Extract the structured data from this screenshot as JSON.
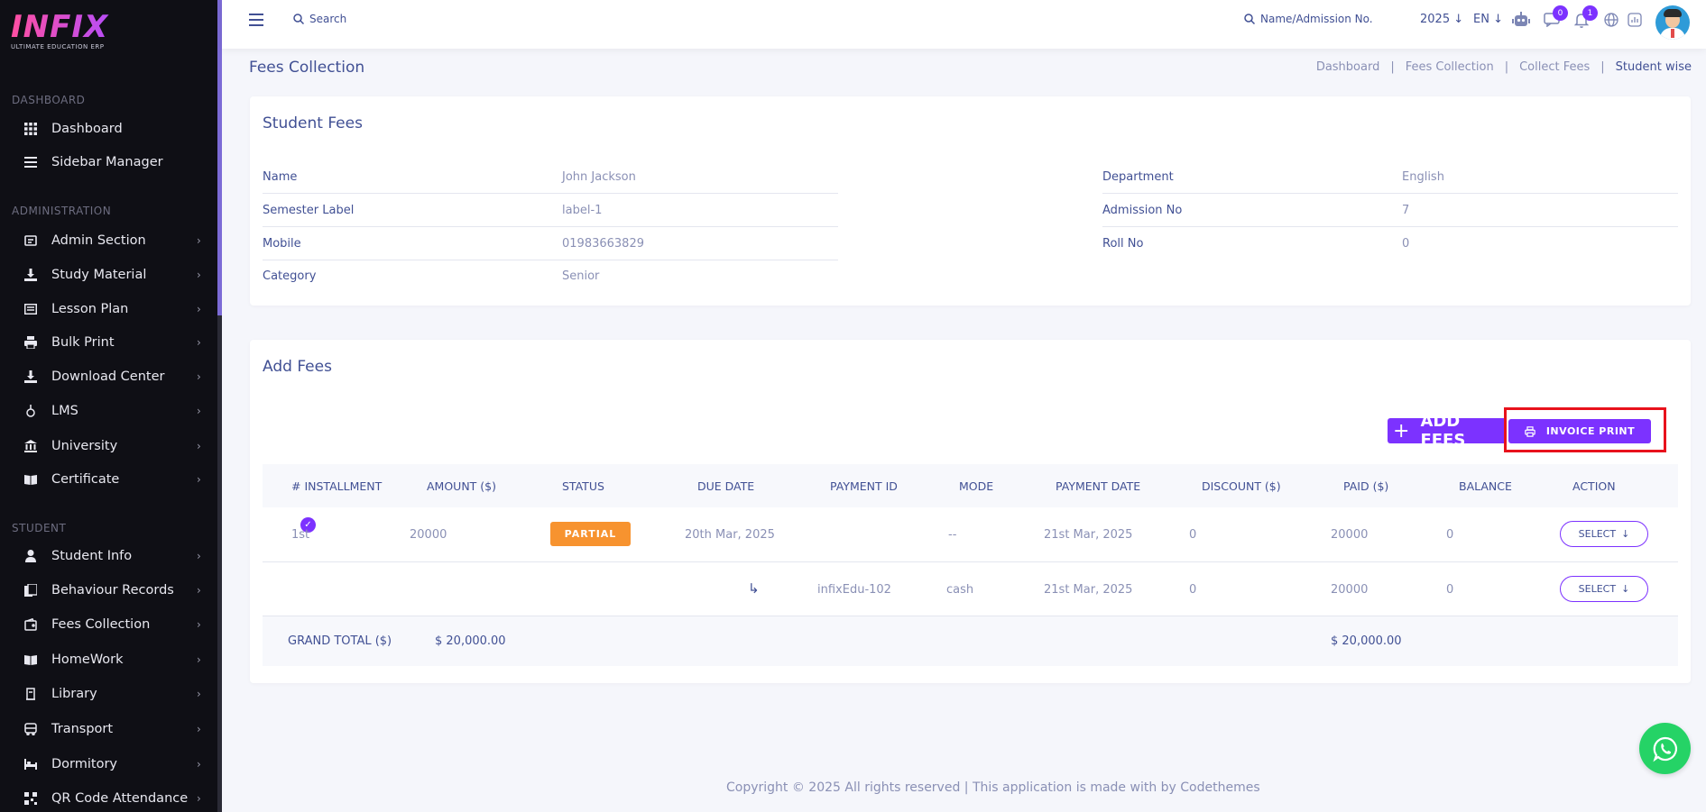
{
  "logo": {
    "text": "INFIX",
    "subtitle": "ULTIMATE EDUCATION ERP"
  },
  "sidebar": {
    "sections": [
      {
        "title": "DASHBOARD"
      },
      {
        "title": "ADMINISTRATION"
      },
      {
        "title": "STUDENT"
      }
    ],
    "items": [
      {
        "label": "Dashboard",
        "icon": "grid-icon"
      },
      {
        "label": "Sidebar Manager",
        "icon": "menu-icon"
      },
      {
        "label": "Admin Section",
        "icon": "admin-icon"
      },
      {
        "label": "Study Material",
        "icon": "download-icon"
      },
      {
        "label": "Lesson Plan",
        "icon": "lesson-icon"
      },
      {
        "label": "Bulk Print",
        "icon": "print-icon"
      },
      {
        "label": "Download Center",
        "icon": "download-icon"
      },
      {
        "label": "LMS",
        "icon": "lms-icon"
      },
      {
        "label": "University",
        "icon": "university-icon"
      },
      {
        "label": "Certificate",
        "icon": "book-icon"
      },
      {
        "label": "Student Info",
        "icon": "user-icon"
      },
      {
        "label": "Behaviour Records",
        "icon": "records-icon"
      },
      {
        "label": "Fees Collection",
        "icon": "fees-icon"
      },
      {
        "label": "HomeWork",
        "icon": "book-icon"
      },
      {
        "label": "Library",
        "icon": "library-icon"
      },
      {
        "label": "Transport",
        "icon": "bus-icon"
      },
      {
        "label": "Dormitory",
        "icon": "bed-icon"
      },
      {
        "label": "QR Code Attendance",
        "icon": "qr-icon"
      }
    ]
  },
  "topbar": {
    "search_label": "Search",
    "student_search_label": "Name/Admission No.",
    "year": "2025",
    "lang": "EN",
    "messages_badge": "0",
    "notifications_badge": "1"
  },
  "page": {
    "title": "Fees Collection",
    "breadcrumb": [
      "Dashboard",
      "Fees Collection",
      "Collect Fees",
      "Student wise"
    ]
  },
  "student_fees": {
    "title": "Student Fees",
    "left": [
      {
        "key": "Name",
        "value": "John Jackson"
      },
      {
        "key": "Semester Label",
        "value": "label-1"
      },
      {
        "key": "Mobile",
        "value": "01983663829"
      },
      {
        "key": "Category",
        "value": "Senior"
      }
    ],
    "right": [
      {
        "key": "Department",
        "value": "English"
      },
      {
        "key": "Admission No",
        "value": "7"
      },
      {
        "key": "Roll No",
        "value": "0"
      }
    ]
  },
  "add_fees": {
    "title": "Add Fees",
    "add_button": "ADD FEES",
    "invoice_button": "INVOICE PRINT",
    "columns": [
      "# INSTALLMENT",
      "AMOUNT ($)",
      "STATUS",
      "DUE DATE",
      "PAYMENT ID",
      "MODE",
      "PAYMENT DATE",
      "DISCOUNT ($)",
      "PAID ($)",
      "BALANCE",
      "ACTION"
    ],
    "rows": [
      {
        "installment": "1st",
        "amount": "20000",
        "status": "PARTIAL",
        "due_date": "20th Mar, 2025",
        "payment_id": "",
        "mode": "--",
        "payment_date": "21st Mar, 2025",
        "discount": "0",
        "paid": "20000",
        "balance": "0",
        "action": "SELECT"
      },
      {
        "installment": "",
        "amount": "",
        "status": "",
        "due_date": "",
        "payment_id": "infixEdu-102",
        "mode": "cash",
        "payment_date": "21st Mar, 2025",
        "discount": "0",
        "paid": "20000",
        "balance": "0",
        "action": "SELECT"
      }
    ],
    "grand_total_label": "GRAND TOTAL ($)",
    "grand_total_amount": "$ 20,000.00",
    "grand_total_paid": "$ 20,000.00"
  },
  "footer": {
    "text": "Copyright © 2025 All rights reserved | This application is made with by Codethemes"
  },
  "colors": {
    "accent": "#7c32ff",
    "status_partial": "#f7932f",
    "highlight": "#e8121c",
    "whatsapp": "#25d366"
  }
}
